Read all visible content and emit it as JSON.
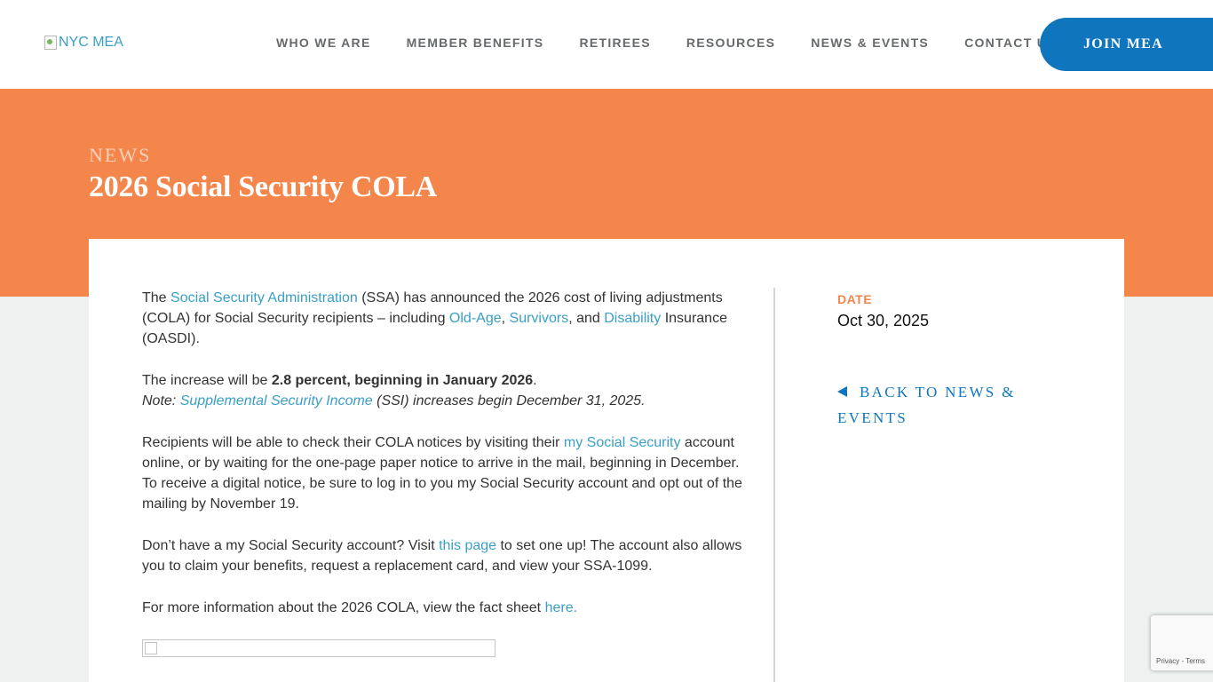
{
  "header": {
    "logo_alt": "NYC MEA",
    "nav": [
      "WHO WE ARE",
      "MEMBER BENEFITS",
      "RETIREES",
      "RESOURCES",
      "NEWS & EVENTS",
      "CONTACT US"
    ],
    "join_label": "JOIN MEA"
  },
  "banner": {
    "eyebrow": "NEWS",
    "title": "2026 Social Security COLA"
  },
  "article": {
    "p1_a": "The ",
    "p1_link1": "Social Security Administration",
    "p1_b": " (SSA) has announced the 2026 cost of living adjustments (COLA) for Social Security recipients – including ",
    "p1_link2": "Old-Age",
    "p1_c": ", ",
    "p1_link3": "Survivors",
    "p1_d": ", and ",
    "p1_link4": "Disability",
    "p1_e": " Insurance (OASDI).",
    "p2_a": "The increase will be ",
    "p2_bold": "2.8 percent, beginning in January 2026",
    "p2_b": ".",
    "p2_note_a": "Note: ",
    "p2_note_link": "Supplemental Security Income",
    "p2_note_b": " (SSI) increases begin December 31, 2025.",
    "p3_a": "Recipients will be able to check their COLA notices by visiting their ",
    "p3_link": "my Social Security",
    "p3_b": " account online, or by waiting for the one-page paper notice to arrive in the mail, beginning in December. To receive a digital notice, be sure to log in to you my Social Security account and opt out of the mailing by November 19.",
    "p4_a": "Don’t have a my Social Security account? Visit ",
    "p4_link": "this page",
    "p4_b": " to set one up!   The account also allows you to claim your benefits, request a replacement card, and view your SSA-1099.",
    "p5_a": "For more information about the 2026 COLA, view the fact sheet ",
    "p5_link": "here."
  },
  "sidebar": {
    "date_label": "DATE",
    "date_value": "Oct 30, 2025",
    "back_label": "BACK TO NEWS & EVENTS"
  },
  "recaptcha": {
    "privacy": "Privacy",
    "separator": " - ",
    "terms": "Terms"
  },
  "colors": {
    "accent_orange": "#f4864c",
    "brand_blue": "#0f75bc",
    "link_blue": "#3a9fc6"
  }
}
